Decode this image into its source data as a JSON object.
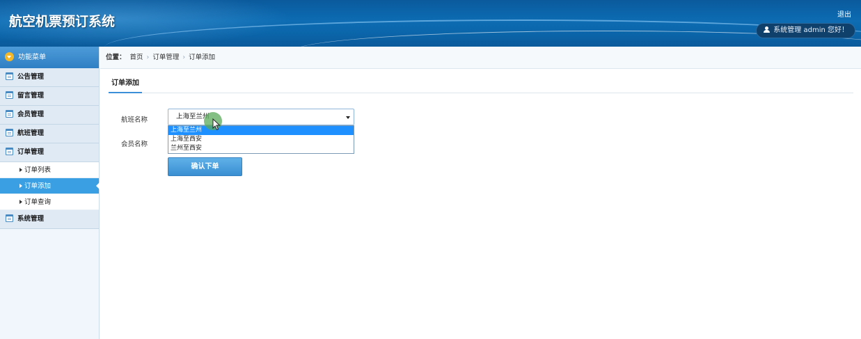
{
  "header": {
    "app_title": "航空机票预订系统",
    "logout_label": "退出",
    "user_greeting": "系统管理 admin 您好！"
  },
  "sidebar": {
    "title": "功能菜单",
    "items": [
      {
        "label": "公告管理"
      },
      {
        "label": "留言管理"
      },
      {
        "label": "会员管理"
      },
      {
        "label": "航班管理"
      },
      {
        "label": "订单管理",
        "expanded": true,
        "children": [
          {
            "label": "订单列表"
          },
          {
            "label": "订单添加",
            "active": true
          },
          {
            "label": "订单查询"
          }
        ]
      },
      {
        "label": "系统管理"
      }
    ]
  },
  "breadcrumb": {
    "prefix": "位置：",
    "parts": [
      "首页",
      "订单管理",
      "订单添加"
    ]
  },
  "page": {
    "tab_label": "订单添加",
    "form": {
      "flight_label": "航班名称",
      "flight_selected": "上海至兰州",
      "flight_options": [
        "上海至兰州",
        "上海至西安",
        "兰州至西安"
      ],
      "member_label": "会员名称",
      "submit_label": "确认下单"
    }
  },
  "colors": {
    "header_bg": "#0d6cb3",
    "sidebar_head": "#2f7fc4",
    "active_item": "#3aa0e3",
    "dropdown_highlight": "#1e90ff",
    "button": "#3a8fd2"
  }
}
